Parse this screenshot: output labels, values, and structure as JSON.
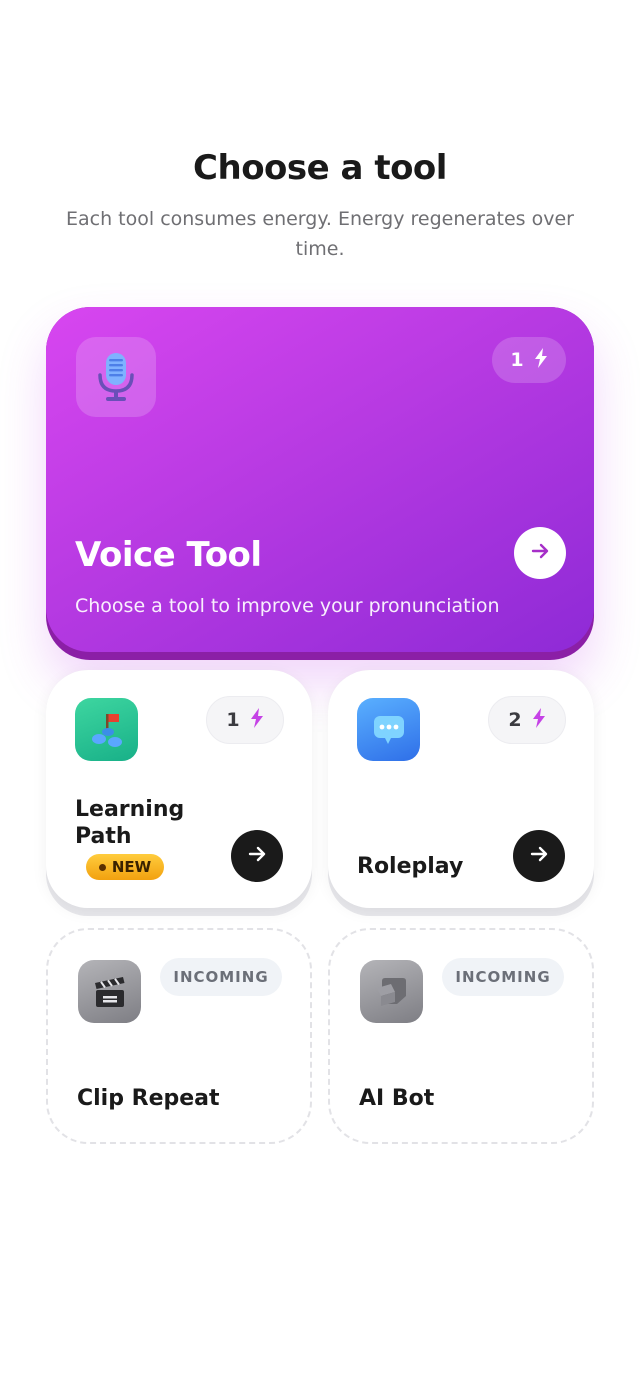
{
  "header": {
    "title": "Choose a tool",
    "subtitle": "Each tool consumes energy. Energy regenerates over time."
  },
  "voice_tool": {
    "title": "Voice Tool",
    "subtitle": "Choose a tool to improve your pronunciation",
    "energy_cost": "1",
    "icon": "microphone-icon"
  },
  "learning_path": {
    "title": "Learning Path",
    "energy_cost": "1",
    "badge": "NEW",
    "icon": "learning-path-icon"
  },
  "roleplay": {
    "title": "Roleplay",
    "energy_cost": "2",
    "icon": "chat-bubble-icon"
  },
  "clip_repeat": {
    "title": "Clip Repeat",
    "status": "INCOMING",
    "icon": "clapperboard-icon"
  },
  "ai_bot": {
    "title": "AI Bot",
    "status": "INCOMING",
    "icon": "bot-icon"
  },
  "colors": {
    "hero_gradient_start": "#d846f0",
    "hero_gradient_end": "#8e2ad6",
    "energy_bolt": "#c542e6",
    "dark_button": "#1a1a1a",
    "new_badge": "#f5b021"
  }
}
